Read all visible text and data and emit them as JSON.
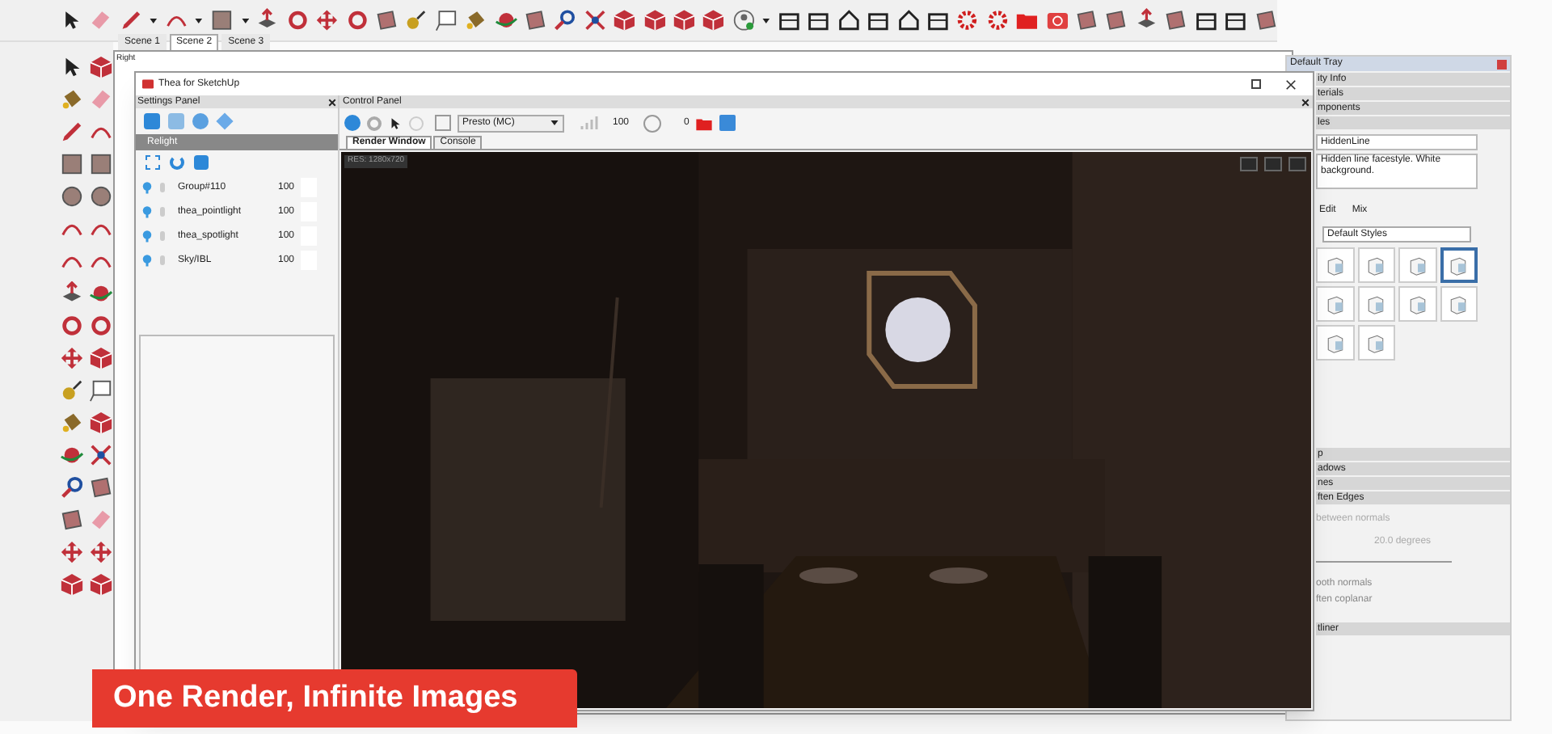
{
  "scene_tabs": [
    {
      "label": "Scene 1",
      "selected": false
    },
    {
      "label": "Scene 2",
      "selected": true
    },
    {
      "label": "Scene 3",
      "selected": false
    }
  ],
  "viewport": {
    "view_label": "Right"
  },
  "thea_window": {
    "title": "Thea for SketchUp",
    "settings_panel": {
      "title": "Settings Panel",
      "section": "Relight",
      "lights": [
        {
          "name": "Group#110",
          "value": "100"
        },
        {
          "name": "thea_pointlight",
          "value": "100"
        },
        {
          "name": "thea_spotlight",
          "value": "100"
        },
        {
          "name": "Sky/IBL",
          "value": "100"
        }
      ]
    },
    "control_panel": {
      "title": "Control Panel",
      "engine": "Presto (MC)",
      "quality": "100",
      "time": "0",
      "resolution": "RES: 1280x720",
      "tabs": [
        {
          "label": "Render Window",
          "selected": true
        },
        {
          "label": "Console",
          "selected": false
        }
      ]
    }
  },
  "tray": {
    "title": "Default Tray",
    "sections_top": [
      "ity Info",
      "terials",
      "mponents",
      "les"
    ],
    "style": {
      "name": "HiddenLine",
      "description": "Hidden line facestyle. White background.",
      "tabs": [
        "Edit",
        "Mix"
      ],
      "collection": "Default Styles",
      "thumbnails": [
        {
          "selected": false
        },
        {
          "selected": false
        },
        {
          "selected": false
        },
        {
          "selected": true
        },
        {
          "selected": false
        },
        {
          "selected": false
        },
        {
          "selected": false
        },
        {
          "selected": false
        },
        {
          "selected": false
        },
        {
          "selected": false
        }
      ]
    },
    "sections_bottom": [
      "p",
      "adows",
      "nes",
      "ften Edges"
    ],
    "edges": {
      "label": "between normals",
      "angle": "20.0  degrees",
      "options": [
        "ooth normals",
        "ften coplanar"
      ]
    },
    "last_section": "tliner"
  },
  "banner": "One Render, Infinite Images"
}
